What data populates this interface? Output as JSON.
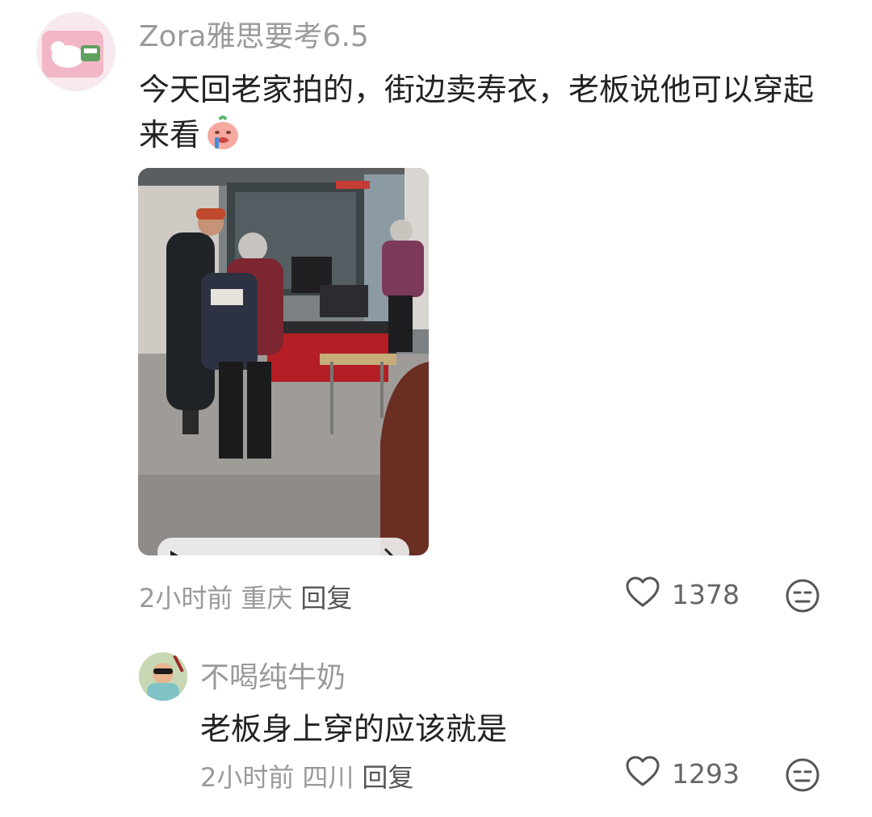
{
  "comments": [
    {
      "username": "Zora雅思要考6.5",
      "text": "今天回老家拍的，街边卖寿衣，老板说他可以穿起来看",
      "time": "2小时前",
      "location": "重庆",
      "reply_label": "回复",
      "likes": "1378"
    },
    {
      "username": "不喝纯牛奶",
      "text": "老板身上穿的应该就是",
      "time": "2小时前",
      "location": "四川",
      "reply_label": "回复",
      "likes": "1293"
    }
  ],
  "icons": {
    "like": "heart-outline-icon",
    "dislike": "neutral-face-icon",
    "emoji": "crying-face-emoji"
  },
  "colors": {
    "username": "#9a9a9a",
    "text": "#222222",
    "meta": "#9a9a9a"
  }
}
